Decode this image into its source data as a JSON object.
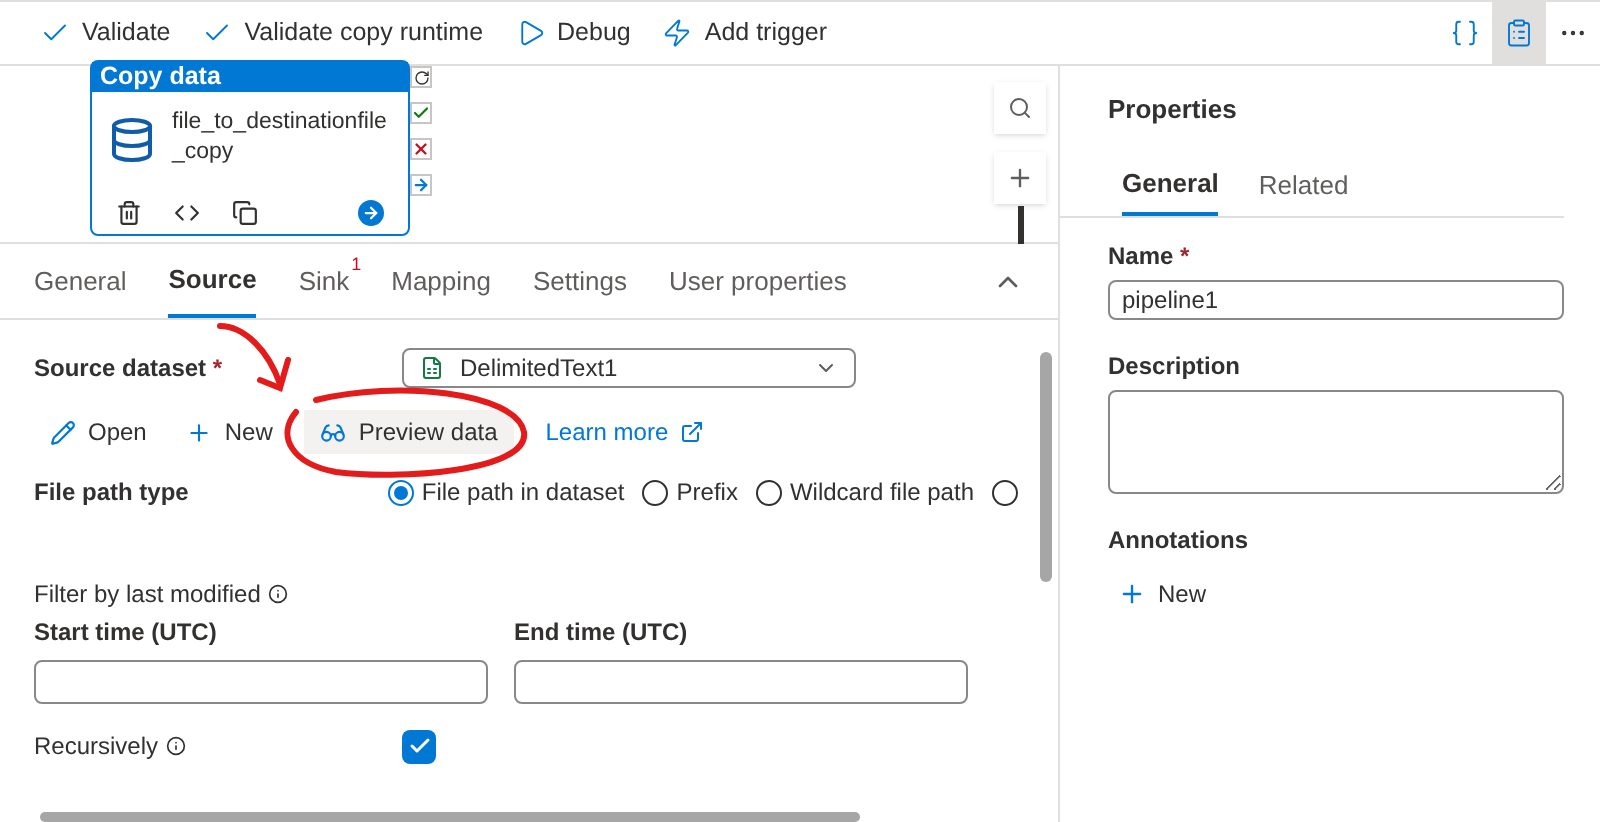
{
  "toolbar": {
    "actions": [
      {
        "label": "Validate",
        "kind": "check"
      },
      {
        "label": "Validate copy runtime",
        "kind": "check"
      },
      {
        "label": "Debug",
        "kind": "play"
      },
      {
        "label": "Add trigger",
        "kind": "trigger"
      }
    ],
    "right_buttons": [
      {
        "kind": "code",
        "selected": false
      },
      {
        "kind": "properties",
        "selected": true
      },
      {
        "kind": "more",
        "selected": false
      }
    ]
  },
  "activity": {
    "type": "Copy data",
    "name": "file_to_destinationfile_copy"
  },
  "tabs": [
    {
      "label": "General",
      "selected": false
    },
    {
      "label": "Source",
      "selected": true
    },
    {
      "label": "Sink",
      "selected": false,
      "badge": "1"
    },
    {
      "label": "Mapping",
      "selected": false
    },
    {
      "label": "Settings",
      "selected": false
    },
    {
      "label": "User properties",
      "selected": false
    }
  ],
  "source": {
    "dataset_label": "Source dataset",
    "required_mark": "*",
    "dataset_value": "DelimitedText1",
    "actions": [
      {
        "label": "Open",
        "kind": "edit"
      },
      {
        "label": "New",
        "kind": "add"
      },
      {
        "label": "Preview data",
        "kind": "preview"
      },
      {
        "label": "Learn more",
        "kind": "link"
      }
    ],
    "file_path_type": {
      "label": "File path type",
      "options": [
        {
          "label": "File path in dataset",
          "selected": true
        },
        {
          "label": "Prefix",
          "selected": false
        },
        {
          "label": "Wildcard file path",
          "selected": false
        },
        {
          "selected": false
        }
      ]
    },
    "filter": {
      "label": "Filter by last modified",
      "start_label": "Start time (UTC)",
      "end_label": "End time (UTC)"
    },
    "recursively": {
      "label": "Recursively",
      "checked": true
    }
  },
  "properties": {
    "title": "Properties",
    "tabs": [
      {
        "label": "General",
        "selected": true
      },
      {
        "label": "Related",
        "selected": false
      }
    ],
    "name_label": "Name",
    "name_required_mark": "*",
    "name_value": "pipeline1",
    "description_label": "Description",
    "annotations_label": "Annotations",
    "new_label": "New"
  }
}
